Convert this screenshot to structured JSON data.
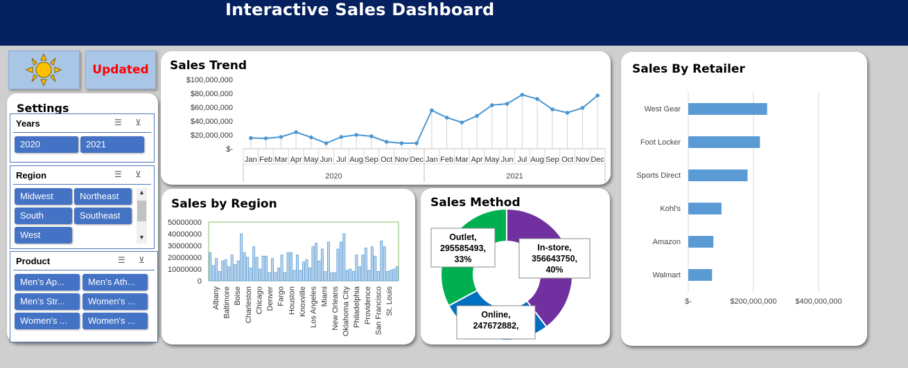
{
  "dashboard": {
    "title": "Interactive Sales Dashboard"
  },
  "status_tile": {
    "label": "Updated",
    "icon": "sun-icon"
  },
  "settings": {
    "title": "Settings",
    "years": {
      "title": "Years",
      "items": [
        "2020",
        "2021"
      ]
    },
    "region": {
      "title": "Region",
      "items": [
        "Midwest",
        "Northeast",
        "South",
        "Southeast",
        "West"
      ]
    },
    "product": {
      "title": "Product",
      "items": [
        "Men's Ap...",
        "Men's Ath...",
        "Men's Str...",
        "Women's ...",
        "Women's ...",
        "Women's ..."
      ]
    },
    "icons": [
      "multi-select-icon",
      "clear-filter-icon"
    ]
  },
  "charts": {
    "trend_title": "Sales Trend",
    "region_title": "Sales by Region",
    "method_title": "Sales Method",
    "retailer_title": "Sales By Retailer"
  },
  "chart_data": [
    {
      "type": "line",
      "title": "Sales Trend",
      "x": [
        "Jan",
        "Feb",
        "Mar",
        "Apr",
        "May",
        "Jun",
        "Jul",
        "Aug",
        "Sep",
        "Oct",
        "Nov",
        "Dec",
        "Jan",
        "Feb",
        "Mar",
        "Apr",
        "May",
        "Jun",
        "Jul",
        "Aug",
        "Sep",
        "Oct",
        "Nov",
        "Dec"
      ],
      "x_groups": [
        {
          "label": "2020",
          "count": 12
        },
        {
          "label": "2021",
          "count": 12
        }
      ],
      "values": [
        15500000,
        15000000,
        17000000,
        24000000,
        16500000,
        8000000,
        17000000,
        20000000,
        18000000,
        10000000,
        8000000,
        8000000,
        55500000,
        45000000,
        38000000,
        47500000,
        63000000,
        65000000,
        78000000,
        72000000,
        57000000,
        52000000,
        59000000,
        77000000
      ],
      "ylim": [
        0,
        100000000
      ],
      "yticks": [
        "$100,000,000",
        "$80,000,000",
        "$60,000,000",
        "$40,000,000",
        "$20,000,000",
        "$-"
      ],
      "color": "#4a96d2"
    },
    {
      "type": "bar",
      "title": "Sales by Region",
      "categories": [
        "Albany",
        "",
        "Baltimore",
        "",
        "Boise",
        "",
        "Charleston",
        "",
        "Chicago",
        "",
        "Denver",
        "",
        "Fargo",
        "",
        "Houston",
        "",
        "Knoxville",
        "",
        "Los Angeles",
        "",
        "Miami",
        "",
        "New Orleans",
        "",
        "Oklahoma City",
        "",
        "Philadelphia",
        "",
        "Providence",
        "",
        "San Francisco",
        "",
        "St. Louis",
        "",
        "",
        "",
        "",
        "",
        "",
        "",
        "",
        "",
        "",
        "",
        "",
        "",
        "",
        "",
        "",
        "",
        ""
      ],
      "values": [
        24000000,
        13000000,
        19000000,
        8000000,
        17000000,
        18000000,
        12000000,
        22000000,
        14000000,
        17000000,
        40000000,
        24000000,
        20000000,
        11000000,
        29000000,
        20000000,
        10000000,
        21000000,
        21000000,
        7000000,
        19000000,
        7000000,
        11000000,
        22000000,
        7000000,
        24000000,
        24000000,
        9000000,
        22000000,
        9000000,
        16000000,
        18000000,
        11000000,
        29000000,
        32000000,
        17000000,
        27000000,
        8000000,
        33000000,
        7000000,
        7000000,
        27000000,
        33000000,
        40000000,
        9000000,
        10000000,
        8000000,
        22000000,
        12000000,
        22000000,
        28000000,
        9000000,
        29000000,
        21000000,
        8000000,
        34000000,
        29000000,
        8000000,
        9000000,
        10000000,
        12000000
      ],
      "city_labels": [
        "Albany",
        "Baltimore",
        "Boise",
        "Charleston",
        "Chicago",
        "Denver",
        "Fargo",
        "Houston",
        "Knoxville",
        "Los Angeles",
        "Miami",
        "New Orleans",
        "Oklahoma City",
        "Philadelphia",
        "Providence",
        "San Francisco",
        "St. Louis"
      ],
      "ylim": [
        0,
        50000000
      ],
      "yticks": [
        "50000000",
        "40000000",
        "30000000",
        "20000000",
        "10000000",
        "0"
      ],
      "color": "#5b9bd5"
    },
    {
      "type": "pie",
      "title": "Sales Method",
      "slices": [
        {
          "name": "In-store",
          "value": 356643750,
          "percent": "40%",
          "color": "#7030a0"
        },
        {
          "name": "Online",
          "value": 247672882,
          "percent": "",
          "color": "#0070c0"
        },
        {
          "name": "Outlet",
          "value": 295585493,
          "percent": "33%",
          "color": "#00b050"
        }
      ],
      "labels": {
        "instore": [
          "In-store,",
          "356643750,",
          "40%"
        ],
        "online": [
          "Online,",
          "247672882,"
        ],
        "outlet": [
          "Outlet,",
          "295585493,",
          "33%"
        ]
      }
    },
    {
      "type": "bar",
      "orientation": "horizontal",
      "title": "Sales By Retailer",
      "categories": [
        "West Gear",
        "Foot Locker",
        "Sports Direct",
        "Kohl's",
        "Amazon",
        "Walmart"
      ],
      "values": [
        242000000,
        220000000,
        182000000,
        102000000,
        77000000,
        73000000
      ],
      "xlim": [
        0,
        500000000
      ],
      "xticks": [
        "$-",
        "$200,000,000",
        "$400,000,000"
      ],
      "color": "#5b9bd5"
    }
  ]
}
